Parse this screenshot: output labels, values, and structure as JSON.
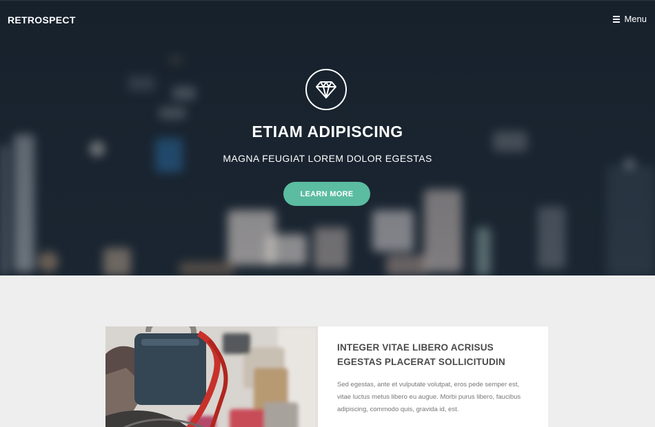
{
  "header": {
    "logo": "RETROSPECT",
    "menu_label": "Menu",
    "menu_icon": "hamburger-icon"
  },
  "hero": {
    "icon": "diamond-icon",
    "title": "ETIAM ADIPISCING",
    "subtitle": "MAGNA FEUGIAT LOREM DOLOR EGESTAS",
    "cta_label": "LEARN MORE"
  },
  "feature": {
    "image_subject": "padlocks on a fence",
    "title_line1": "INTEGER VITAE LIBERO ACRISUS",
    "title_line2": "EGESTAS PLACERAT SOLLICITUDIN",
    "body_line1": "Sed egestas, ante et vulputate volutpat, eros pede semper est,",
    "body_line2": "vitae luctus metus libero eu augue. Morbi purus libero, faucibus",
    "body_line3": "adipiscing, commodo quis, gravida id, est."
  },
  "colors": {
    "accent": "#5bbca2",
    "hero_bg": "#1c2733",
    "page_bg": "#eeeeee",
    "text_dark": "#4a4a4a",
    "text_muted": "#777777"
  }
}
